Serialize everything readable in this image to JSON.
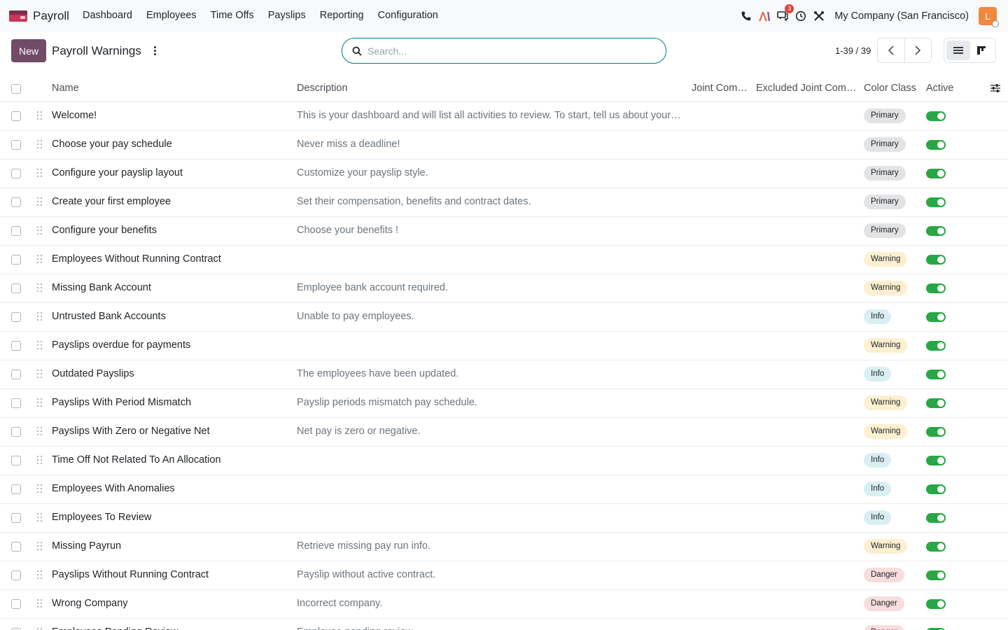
{
  "navbar": {
    "app_name": "Payroll",
    "menu": [
      "Dashboard",
      "Employees",
      "Time Offs",
      "Payslips",
      "Reporting",
      "Configuration"
    ],
    "messages_count": "3",
    "company": "My Company (San Francisco)",
    "avatar_letter": "L"
  },
  "control": {
    "new_label": "New",
    "title": "Payroll Warnings",
    "search_placeholder": "Search...",
    "pager": "1-39 / 39"
  },
  "columns": {
    "name": "Name",
    "description": "Description",
    "joint": "Joint Com…",
    "excluded_joint": "Excluded Joint Com…",
    "color_class": "Color Class",
    "active": "Active"
  },
  "rows": [
    {
      "name": "Welcome!",
      "description": "This is your dashboard and will list all activities to review. To start, tell us about your bu…",
      "color": "Primary",
      "active": true
    },
    {
      "name": "Choose your pay schedule",
      "description": "Never miss a deadline!",
      "color": "Primary",
      "active": true
    },
    {
      "name": "Configure your payslip layout",
      "description": "Customize your payslip style.",
      "color": "Primary",
      "active": true
    },
    {
      "name": "Create your first employee",
      "description": "Set their compensation, benefits and contract dates.",
      "color": "Primary",
      "active": true
    },
    {
      "name": "Configure your benefits",
      "description": "Choose your benefits !",
      "color": "Primary",
      "active": true
    },
    {
      "name": "Employees Without Running Contract",
      "description": "",
      "color": "Warning",
      "active": true
    },
    {
      "name": "Missing Bank Account",
      "description": "Employee bank account required.",
      "color": "Warning",
      "active": true
    },
    {
      "name": "Untrusted Bank Accounts",
      "description": "Unable to pay employees.",
      "color": "Info",
      "active": true
    },
    {
      "name": "Payslips overdue for payments",
      "description": "",
      "color": "Warning",
      "active": true
    },
    {
      "name": "Outdated Payslips",
      "description": "The employees have been updated.",
      "color": "Info",
      "active": true
    },
    {
      "name": "Payslips With Period Mismatch",
      "description": "Payslip periods mismatch pay schedule.",
      "color": "Warning",
      "active": true
    },
    {
      "name": "Payslips With Zero or Negative Net",
      "description": "Net pay is zero or negative.",
      "color": "Warning",
      "active": true
    },
    {
      "name": "Time Off Not Related To An Allocation",
      "description": "",
      "color": "Info",
      "active": true
    },
    {
      "name": "Employees With Anomalies",
      "description": "",
      "color": "Info",
      "active": true
    },
    {
      "name": "Employees To Review",
      "description": "",
      "color": "Info",
      "active": true
    },
    {
      "name": "Missing Payrun",
      "description": "Retrieve missing pay run info.",
      "color": "Warning",
      "active": true
    },
    {
      "name": "Payslips Without Running Contract",
      "description": "Payslip without active contract.",
      "color": "Danger",
      "active": true
    },
    {
      "name": "Wrong Company",
      "description": "Incorrect company.",
      "color": "Danger",
      "active": true
    },
    {
      "name": "Employees Pending Review",
      "description": "Employee pending review.",
      "color": "Danger",
      "active": true
    }
  ],
  "colors": {
    "brand": "#714b67",
    "search_border": "#017e84",
    "toggle_on": "#28a745",
    "primary_pill": "#e2e3e5",
    "warning_pill": "#fdf0d0",
    "info_pill": "#d9eff3",
    "danger_pill": "#f9dcdc"
  }
}
